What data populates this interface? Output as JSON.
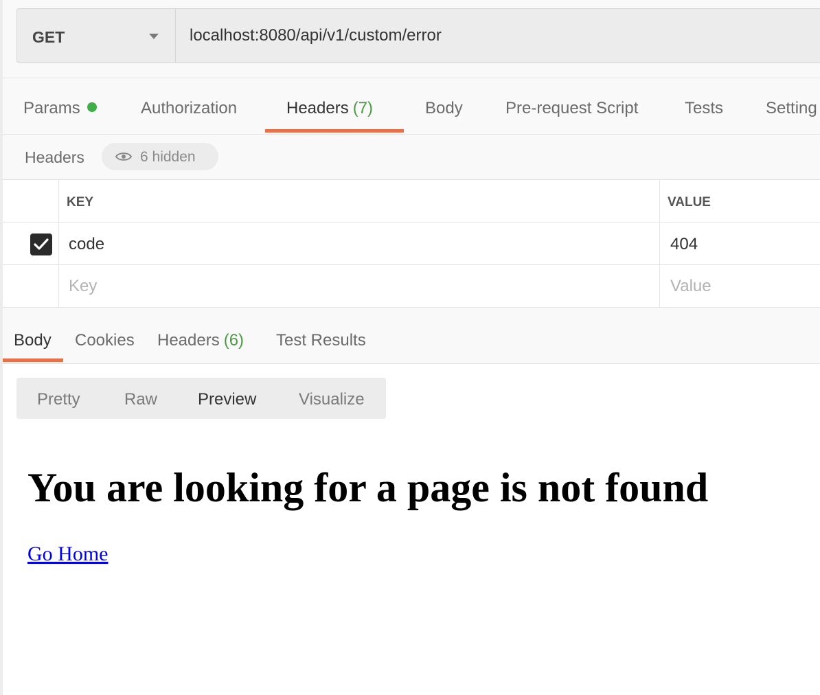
{
  "request": {
    "method": "GET",
    "url": "localhost:8080/api/v1/custom/error"
  },
  "request_tabs": [
    {
      "label": "Params",
      "count": "",
      "indicator": true
    },
    {
      "label": "Authorization",
      "count": ""
    },
    {
      "label": "Headers",
      "count": "(7)",
      "active": true
    },
    {
      "label": "Body",
      "count": ""
    },
    {
      "label": "Pre-request Script",
      "count": ""
    },
    {
      "label": "Tests",
      "count": ""
    },
    {
      "label": "Setting",
      "count": ""
    }
  ],
  "headers_section": {
    "title": "Headers",
    "hidden_label": "6 hidden",
    "columns": {
      "key": "KEY",
      "value": "VALUE"
    },
    "rows": [
      {
        "checked": true,
        "key": "code",
        "value": "404"
      }
    ],
    "placeholder": {
      "key": "Key",
      "value": "Value"
    }
  },
  "response_tabs": [
    {
      "label": "Body",
      "count": "",
      "active": true
    },
    {
      "label": "Cookies",
      "count": ""
    },
    {
      "label": "Headers",
      "count": "(6)"
    },
    {
      "label": "Test Results",
      "count": ""
    }
  ],
  "view_modes": [
    {
      "label": "Pretty"
    },
    {
      "label": "Raw"
    },
    {
      "label": "Preview",
      "active": true
    },
    {
      "label": "Visualize"
    }
  ],
  "preview": {
    "title": "You are looking for a page is not found",
    "link": "Go Home"
  },
  "colors": {
    "accent": "#e8704a",
    "count_green": "#4c9a44",
    "indicator_green": "#3fae49",
    "link_blue": "#0000ee"
  }
}
